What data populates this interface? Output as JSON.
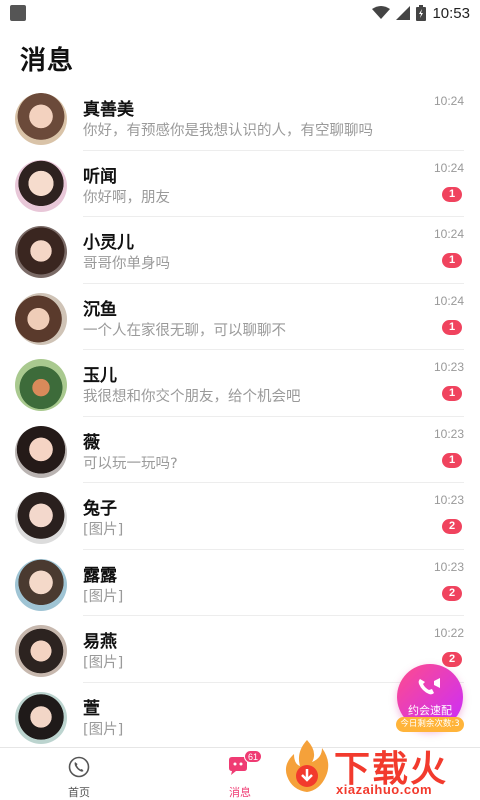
{
  "status_bar": {
    "time": "10:53"
  },
  "header": {
    "title": "消息"
  },
  "conversations": [
    {
      "name": "真善美",
      "preview": "你好，有预感你是我想认识的人，有空聊聊吗",
      "time": "10:24",
      "unread": ""
    },
    {
      "name": "听闻",
      "preview": "你好啊，朋友",
      "time": "10:24",
      "unread": "1"
    },
    {
      "name": "小灵儿",
      "preview": "哥哥你单身吗",
      "time": "10:24",
      "unread": "1"
    },
    {
      "name": "沉鱼",
      "preview": "一个人在家很无聊，可以聊聊不",
      "time": "10:24",
      "unread": "1"
    },
    {
      "name": "玉儿",
      "preview": "我很想和你交个朋友，给个机会吧",
      "time": "10:23",
      "unread": "1"
    },
    {
      "name": "薇",
      "preview": "可以玩一玩吗?",
      "time": "10:23",
      "unread": "1"
    },
    {
      "name": "兔子",
      "preview": "[图片]",
      "time": "10:23",
      "unread": "2"
    },
    {
      "name": "露露",
      "preview": "[图片]",
      "time": "10:23",
      "unread": "2"
    },
    {
      "name": "易燕",
      "preview": "[图片]",
      "time": "10:22",
      "unread": "2"
    },
    {
      "name": "萱",
      "preview": "[图片]",
      "time": "",
      "unread": ""
    }
  ],
  "fab": {
    "label": "约会速配",
    "sub_label": "今日剩余次数:3"
  },
  "bottom_nav": {
    "home_label": "首页",
    "messages_label": "消息",
    "messages_count": "61"
  },
  "watermark": {
    "text": "下载火",
    "url": "xiazaihuo.com"
  },
  "colors": {
    "accent": "#ef3b73",
    "badge": "#f0435e",
    "fab_start": "#ff4c8b",
    "fab_end": "#c92cff",
    "fab_sub": "#ffb43a",
    "watermark": "#f23a2d"
  }
}
